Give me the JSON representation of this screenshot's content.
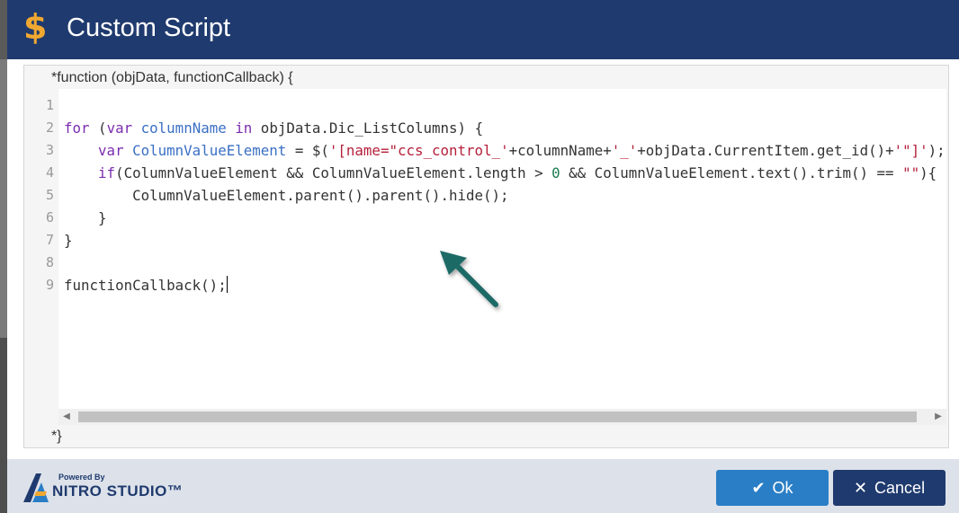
{
  "dialog": {
    "title": "Custom Script",
    "title_icon": "dollar-icon"
  },
  "editor": {
    "header": "*function (objData, functionCallback) {",
    "footer_marker": "*",
    "footer_brace": "}",
    "line_numbers": [
      "1",
      "2",
      "3",
      "4",
      "5",
      "6",
      "7",
      "8",
      "9"
    ],
    "lines": [
      "",
      "for (var columnName in objData.Dic_ListColumns) {",
      "    var ColumnValueElement = $('[name=\"ccs_control_'+columnName+'_'+objData.CurrentItem.get_id()+'\"]');",
      "    if(ColumnValueElement && ColumnValueElement.length > 0 && ColumnValueElement.text().trim() == \"\"){",
      "        ColumnValueElement.parent().parent().hide();",
      "    }",
      "}",
      "",
      "functionCallback();"
    ]
  },
  "footer": {
    "logo_powered": "Powered By",
    "logo_brand": "NITRO STUDIO™",
    "ok_label": "Ok",
    "cancel_label": "Cancel",
    "ok_icon": "check-icon",
    "cancel_icon": "close-icon"
  },
  "colors": {
    "titlebar": "#1f3a6e",
    "accent_icon": "#f0a830",
    "ok_button": "#2a7ec6",
    "cancel_button": "#1f3a6e",
    "annotation_arrow": "#1e6b66"
  }
}
